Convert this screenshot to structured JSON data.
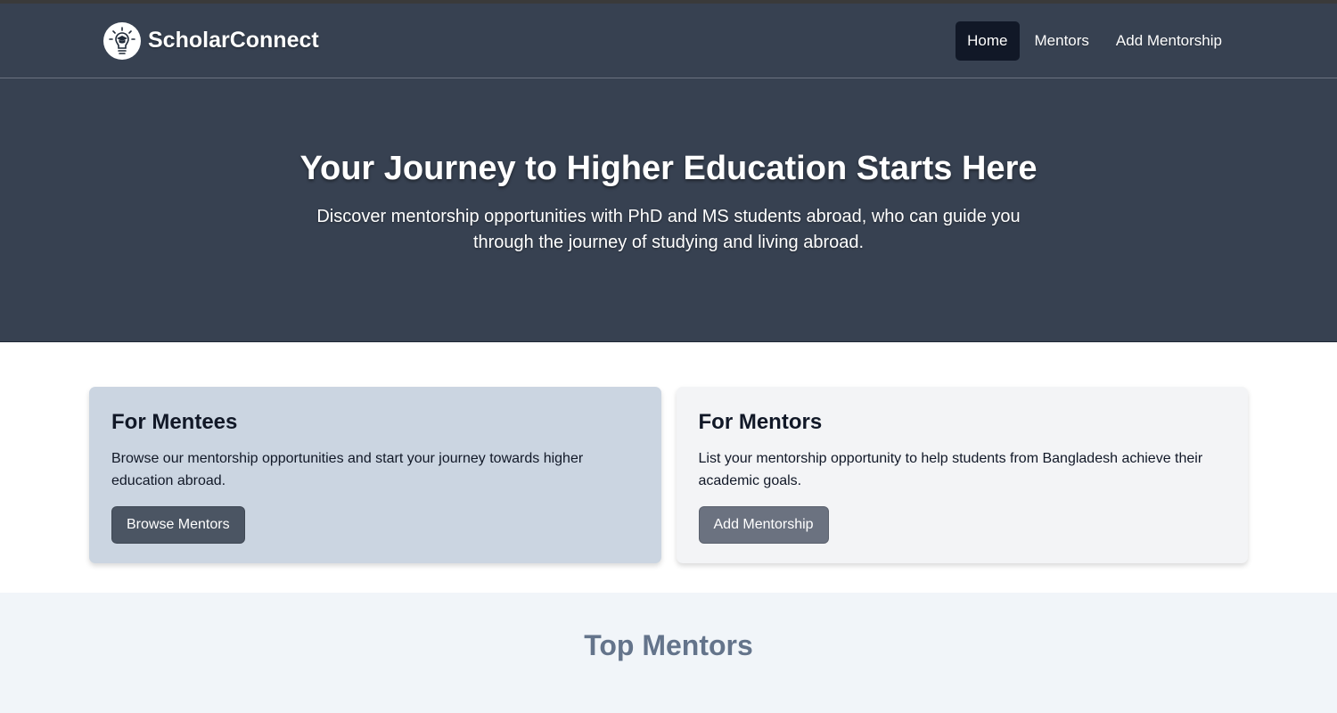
{
  "header": {
    "brand": "ScholarConnect",
    "nav": [
      {
        "label": "Home"
      },
      {
        "label": "Mentors"
      },
      {
        "label": "Add Mentorship"
      }
    ]
  },
  "hero": {
    "title": "Your Journey to Higher Education Starts Here",
    "subtitle": "Discover mentorship opportunities with PhD and MS students abroad, who can guide you through the journey of studying and living abroad."
  },
  "cards": {
    "mentees": {
      "title": "For Mentees",
      "text": "Browse our mentorship opportunities and start your journey towards higher education abroad.",
      "button": "Browse Mentors"
    },
    "mentors": {
      "title": "For Mentors",
      "text": "List your mentorship opportunity to help students from Bangladesh achieve their academic goals.",
      "button": "Add Mentorship"
    }
  },
  "top_mentors": {
    "title": "Top Mentors"
  },
  "colors": {
    "header_bg": "#374151",
    "nav_active_bg": "#111827",
    "mentees_card_bg": "#cbd5e1",
    "mentors_card_bg": "#f3f4f6",
    "section_bg": "#f1f5f9"
  },
  "icons": {
    "logo": "lightbulb-graduation-cap-icon"
  }
}
